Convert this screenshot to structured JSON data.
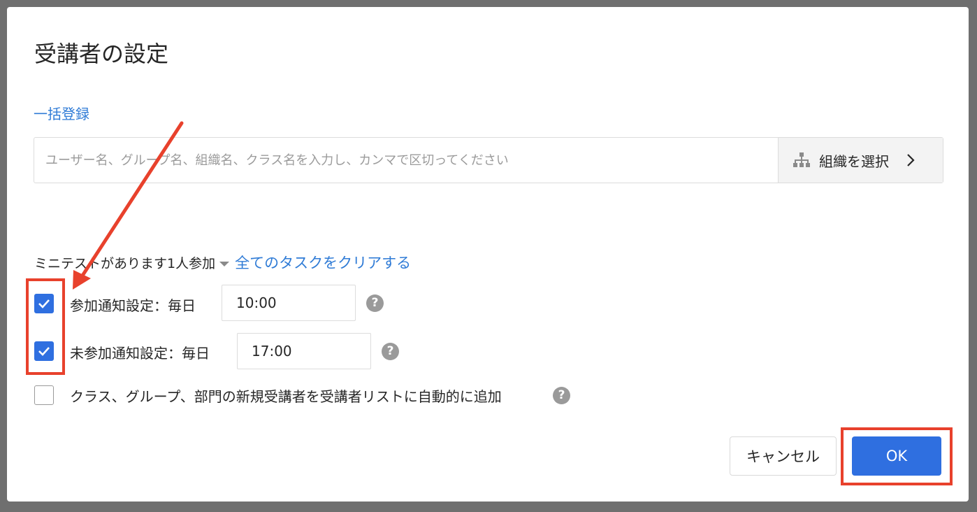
{
  "dialog": {
    "title": "受講者の設定",
    "bulk_register_link": "一括登録",
    "search": {
      "placeholder": "ユーザー名、グループ名、組織名、クラス名を入力し、カンマで区切ってください",
      "value": ""
    },
    "org_select": {
      "label": "組織を選択",
      "icon": "org-chart-icon"
    },
    "task_summary": "ミニテストがあります1人参加",
    "clear_tasks_link": "全てのタスクをクリアする",
    "options": [
      {
        "label": "参加通知設定：毎日",
        "checked": true,
        "time": "10:00"
      },
      {
        "label": "未参加通知設定：毎日",
        "checked": true,
        "time": "17:00"
      },
      {
        "label": "クラス、グループ、部門の新規受講者を受講者リストに自動的に追加",
        "checked": false
      }
    ],
    "help_symbol": "?",
    "buttons": {
      "cancel": "キャンセル",
      "ok": "OK"
    }
  },
  "colors": {
    "accent": "#2f6fe0",
    "link": "#2f7bd6",
    "annotation": "#e8412c"
  }
}
